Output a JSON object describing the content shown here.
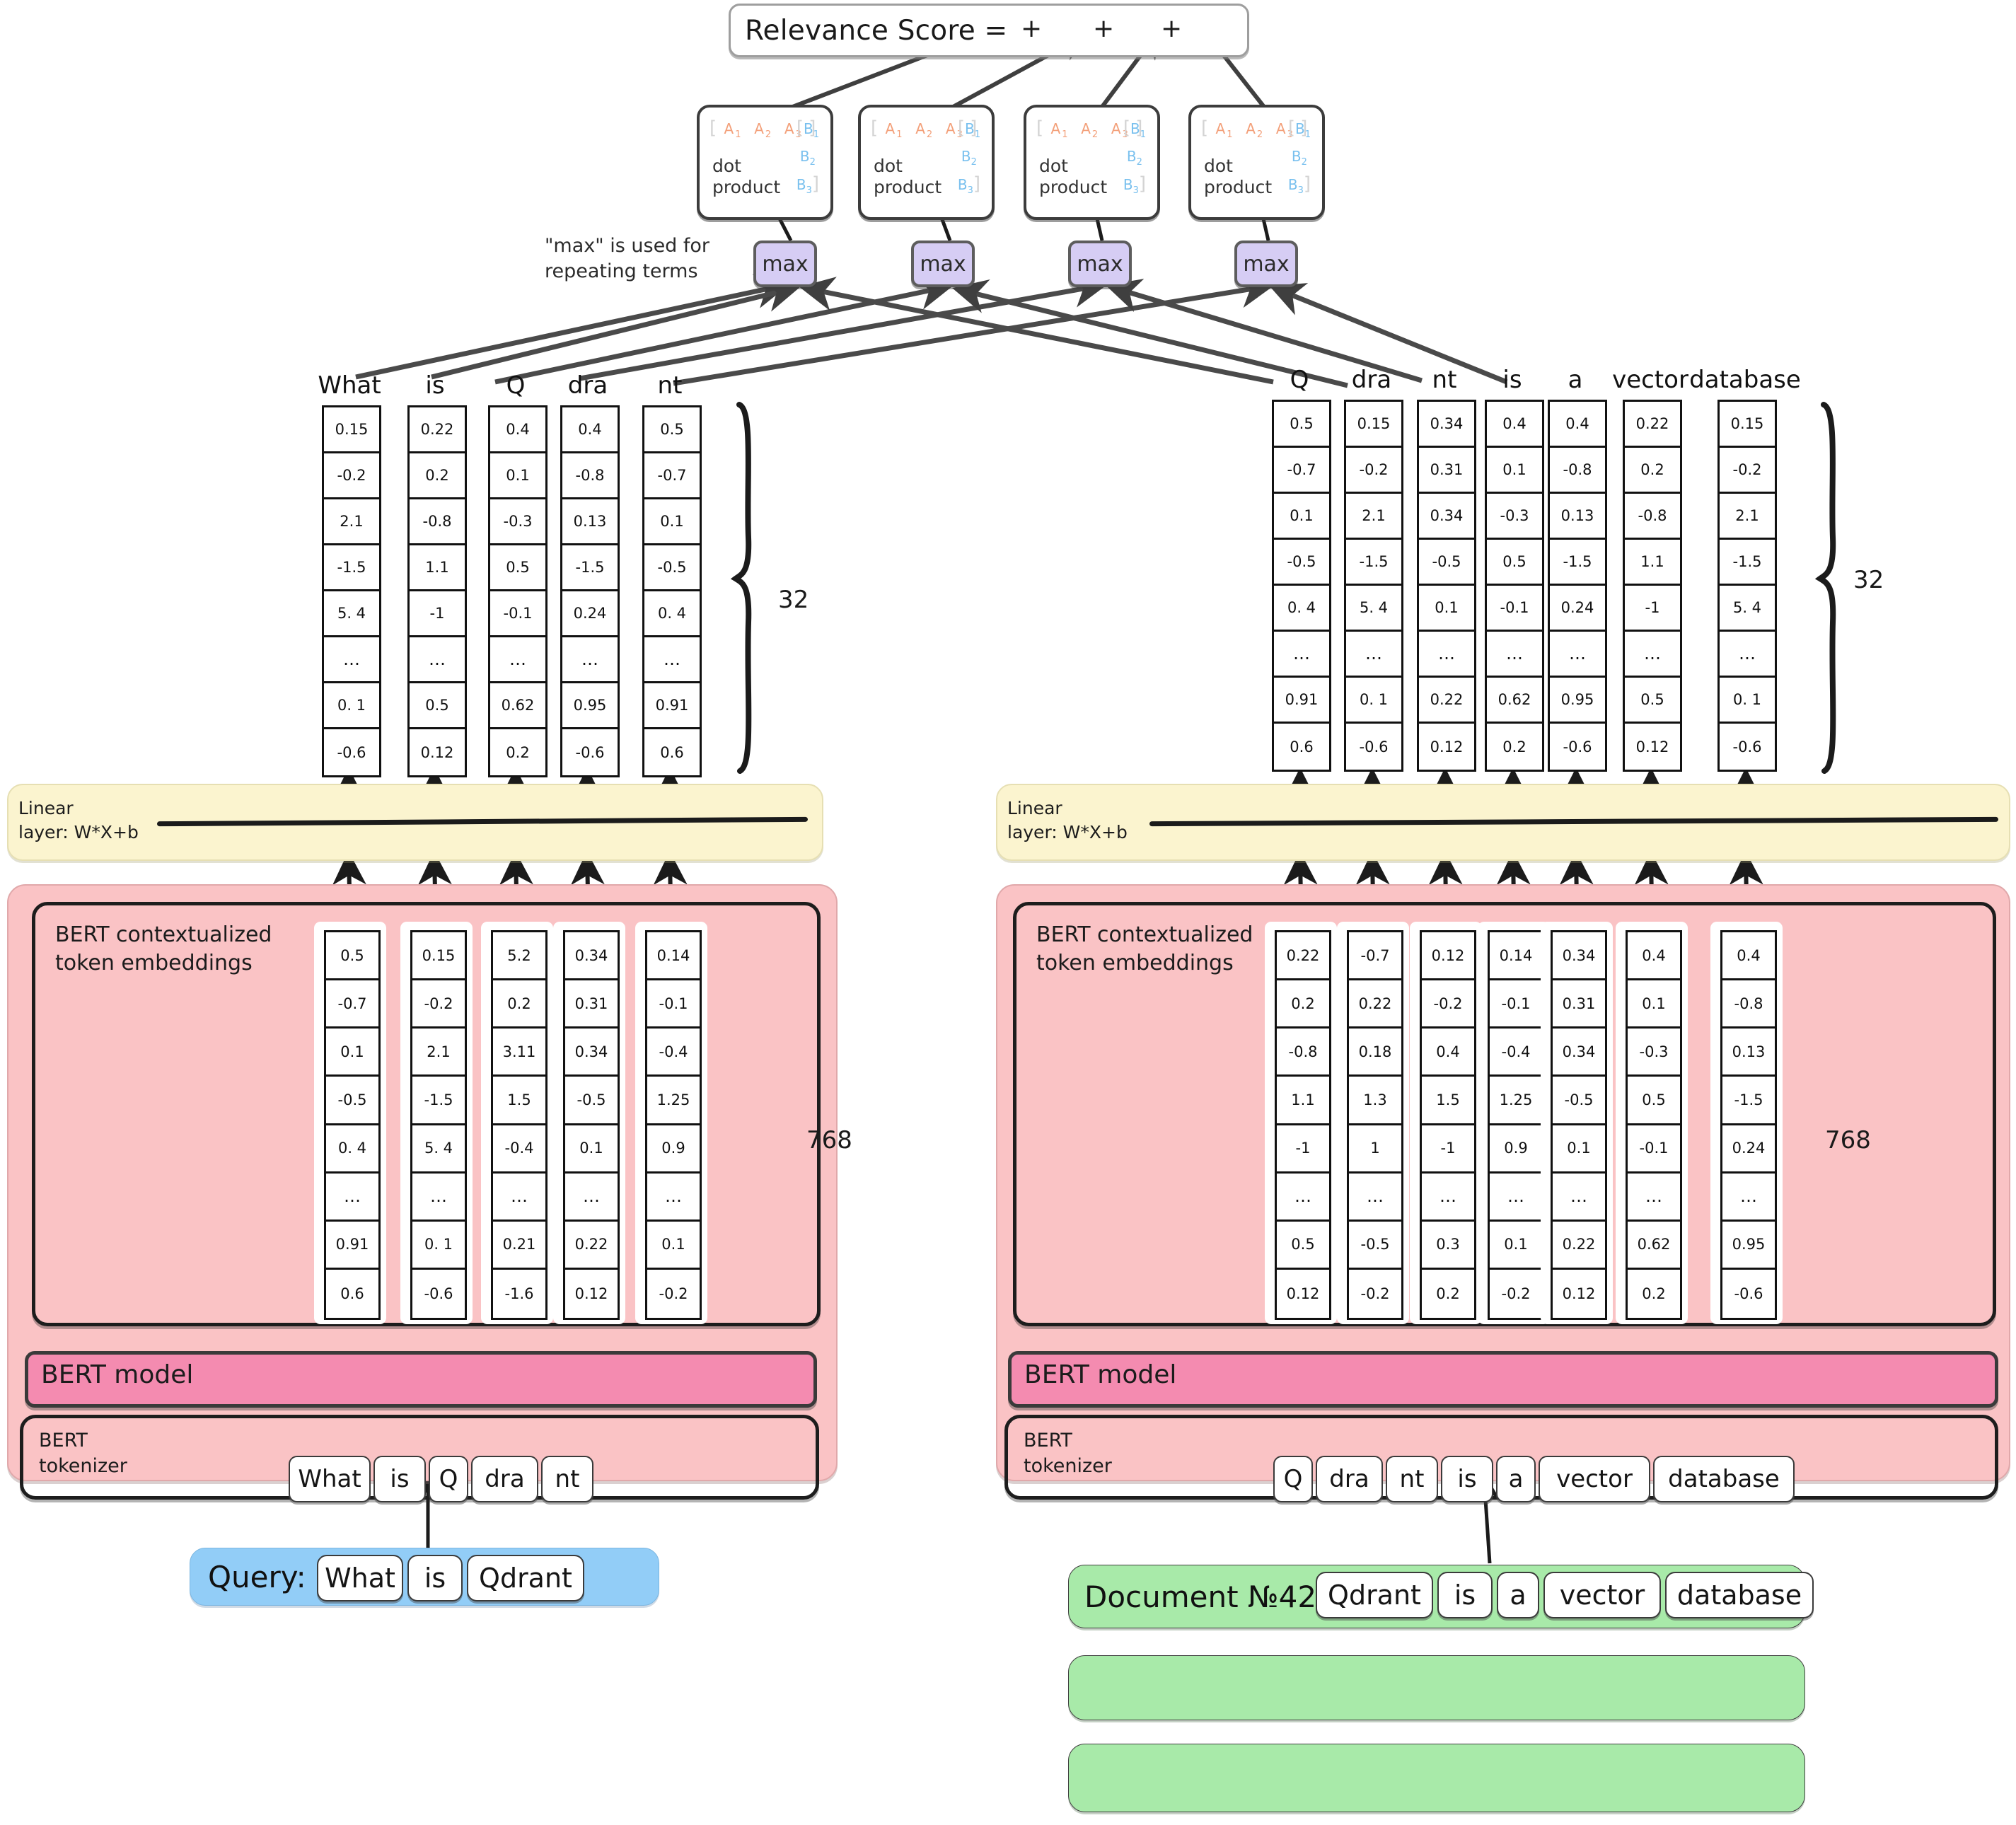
{
  "top": {
    "relevance_label": "Relevance Score =",
    "plus_signs": [
      "+",
      "+",
      "+"
    ],
    "dot_product_cards": [
      {
        "label": "dot\nproduct",
        "a_terms": [
          "A₁",
          "A₂",
          "A₃"
        ],
        "b_terms": [
          "B₁",
          "B₂",
          "B₃"
        ]
      },
      {
        "label": "dot\nproduct",
        "a_terms": [
          "A₁",
          "A₂",
          "A₃"
        ],
        "b_terms": [
          "B₁",
          "B₂",
          "B₃"
        ]
      },
      {
        "label": "dot\nproduct",
        "a_terms": [
          "A₁",
          "A₂",
          "A₃"
        ],
        "b_terms": [
          "B₁",
          "B₂",
          "B₃"
        ]
      },
      {
        "label": "dot\nproduct",
        "a_terms": [
          "A₁",
          "A₂",
          "A₃"
        ],
        "b_terms": [
          "B₁",
          "B₂",
          "B₃"
        ]
      }
    ],
    "max_boxes": [
      "max",
      "max",
      "max",
      "max"
    ],
    "max_note": "\"max\" is used for repeating terms"
  },
  "query_side": {
    "output_dim_label": "32",
    "hidden_dim_label": "768",
    "linear_layer_label": "Linear\nlayer: W*X+b",
    "bert_embeddings_label": "BERT contextualized\ntoken embeddings",
    "bert_model_label": "BERT model",
    "bert_tokenizer_label": "BERT\ntokenizer",
    "tokens": [
      "What",
      "is",
      "Q",
      "dra",
      "nt"
    ],
    "input_label": "Query:",
    "input_words": [
      "What",
      "is",
      "Qdrant"
    ],
    "output_vectors": [
      {
        "token": "What",
        "values": [
          "0.15",
          "-0.2",
          "2.1",
          "-1.5",
          "5. 4",
          "…",
          "0. 1",
          "-0.6"
        ]
      },
      {
        "token": "is",
        "values": [
          "0.22",
          "0.2",
          "-0.8",
          "1.1",
          "-1",
          "…",
          "0.5",
          "0.12"
        ]
      },
      {
        "token": "Q",
        "values": [
          "0.4",
          "0.1",
          "-0.3",
          "0.5",
          "-0.1",
          "…",
          "0.62",
          "0.2"
        ]
      },
      {
        "token": "dra",
        "values": [
          "0.4",
          "-0.8",
          "0.13",
          "-1.5",
          "0.24",
          "…",
          "0.95",
          "-0.6"
        ]
      },
      {
        "token": "nt",
        "values": [
          "0.5",
          "-0.7",
          "0.1",
          "-0.5",
          "0. 4",
          "…",
          "0.91",
          "0.6"
        ]
      }
    ],
    "embedding_vectors": [
      {
        "token": "What",
        "values": [
          "0.5",
          "-0.7",
          "0.1",
          "-0.5",
          "0. 4",
          "…",
          "0.91",
          "0.6"
        ]
      },
      {
        "token": "is",
        "values": [
          "0.15",
          "-0.2",
          "2.1",
          "-1.5",
          "5. 4",
          "…",
          "0. 1",
          "-0.6"
        ]
      },
      {
        "token": "Q",
        "values": [
          "5.2",
          "0.2",
          "3.11",
          "1.5",
          "-0.4",
          "…",
          "0.21",
          "-1.6"
        ]
      },
      {
        "token": "dra",
        "values": [
          "0.34",
          "0.31",
          "0.34",
          "-0.5",
          "0.1",
          "…",
          "0.22",
          "0.12"
        ]
      },
      {
        "token": "nt",
        "values": [
          "0.14",
          "-0.1",
          "-0.4",
          "1.25",
          "0.9",
          "…",
          "0.1",
          "-0.2"
        ]
      }
    ]
  },
  "document_side": {
    "output_dim_label": "32",
    "hidden_dim_label": "768",
    "linear_layer_label": "Linear\nlayer: W*X+b",
    "bert_embeddings_label": "BERT contextualized\ntoken embeddings",
    "bert_model_label": "BERT model",
    "bert_tokenizer_label": "BERT\ntokenizer",
    "tokens": [
      "Q",
      "dra",
      "nt",
      "is",
      "a",
      "vector",
      "database"
    ],
    "input_label": "Document №42:",
    "input_words": [
      "Qdrant",
      "is",
      "a",
      "vector",
      "database"
    ],
    "extra_empty_documents": 2,
    "output_vectors": [
      {
        "token": "Q",
        "values": [
          "0.5",
          "-0.7",
          "0.1",
          "-0.5",
          "0. 4",
          "…",
          "0.91",
          "0.6"
        ]
      },
      {
        "token": "dra",
        "values": [
          "0.15",
          "-0.2",
          "2.1",
          "-1.5",
          "5. 4",
          "…",
          "0. 1",
          "-0.6"
        ]
      },
      {
        "token": "nt",
        "values": [
          "0.34",
          "0.31",
          "0.34",
          "-0.5",
          "0.1",
          "…",
          "0.22",
          "0.12"
        ]
      },
      {
        "token": "is",
        "values": [
          "0.4",
          "0.1",
          "-0.3",
          "0.5",
          "-0.1",
          "…",
          "0.62",
          "0.2"
        ]
      },
      {
        "token": "a",
        "values": [
          "0.4",
          "-0.8",
          "0.13",
          "-1.5",
          "0.24",
          "…",
          "0.95",
          "-0.6"
        ]
      },
      {
        "token": "vector",
        "values": [
          "0.22",
          "0.2",
          "-0.8",
          "1.1",
          "-1",
          "…",
          "0.5",
          "0.12"
        ]
      },
      {
        "token": "database",
        "values": [
          "0.15",
          "-0.2",
          "2.1",
          "-1.5",
          "5. 4",
          "…",
          "0. 1",
          "-0.6"
        ]
      }
    ],
    "embedding_vectors": [
      {
        "token": "Q",
        "values": [
          "0.22",
          "0.2",
          "-0.8",
          "1.1",
          "-1",
          "…",
          "0.5",
          "0.12"
        ]
      },
      {
        "token": "dra",
        "values": [
          "-0.7",
          "0.22",
          "0.18",
          "1.3",
          "1",
          "…",
          "-0.5",
          "-0.2"
        ]
      },
      {
        "token": "nt",
        "values": [
          "0.12",
          "-0.2",
          "0.4",
          "1.5",
          "-1",
          "…",
          "0.3",
          "0.2"
        ]
      },
      {
        "token": "is",
        "values": [
          "0.14",
          "-0.1",
          "-0.4",
          "1.25",
          "0.9",
          "…",
          "0.1",
          "-0.2"
        ]
      },
      {
        "token": "a",
        "values": [
          "0.34",
          "0.31",
          "0.34",
          "-0.5",
          "0.1",
          "…",
          "0.22",
          "0.12"
        ]
      },
      {
        "token": "vector",
        "values": [
          "0.4",
          "0.1",
          "-0.3",
          "0.5",
          "-0.1",
          "…",
          "0.62",
          "0.2"
        ]
      },
      {
        "token": "database",
        "values": [
          "0.4",
          "-0.8",
          "0.13",
          "-1.5",
          "0.24",
          "…",
          "0.95",
          "-0.6"
        ]
      }
    ]
  },
  "colors": {
    "pink_panel": "#fac3c5",
    "bert_model": "#f48bb0",
    "linear_layer": "#fbf4cf",
    "max_box": "#d6cdf4",
    "query_box": "#92cdf7",
    "document_box": "#a8eaa9",
    "matrix_a": "#f3a07a",
    "matrix_b": "#79c0ee"
  }
}
